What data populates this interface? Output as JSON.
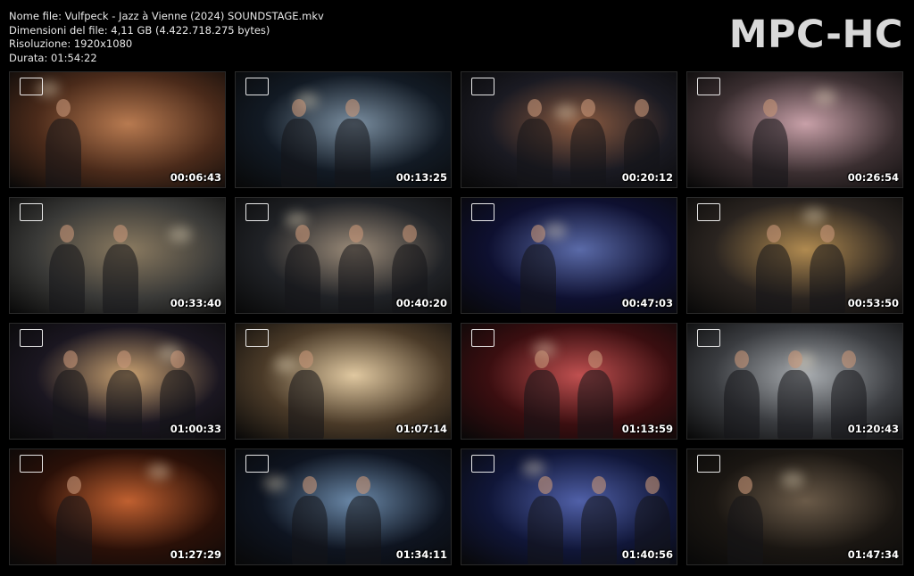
{
  "header": {
    "file_name": "Nome file: Vulfpeck - Jazz à Vienne (2024) SOUNDSTAGE.mkv",
    "file_size": "Dimensioni del file: 4,11 GB (4.422.718.275 bytes)",
    "resolution": "Risoluzione: 1920x1080",
    "duration": "Durata: 01:54:22",
    "brand": "MPC-HC"
  },
  "thumbnails": [
    {
      "time": "00:06:43",
      "bg": "#4a2a1a",
      "accent": "#b87a50"
    },
    {
      "time": "00:13:25",
      "bg": "#121a24",
      "accent": "#7a8ea0"
    },
    {
      "time": "00:20:12",
      "bg": "#1a1a22",
      "accent": "#8a5a40"
    },
    {
      "time": "00:26:54",
      "bg": "#3a2e30",
      "accent": "#c8a0a8"
    },
    {
      "time": "00:33:40",
      "bg": "#3a3a38",
      "accent": "#8a7a60"
    },
    {
      "time": "00:40:20",
      "bg": "#202226",
      "accent": "#9a8a78"
    },
    {
      "time": "00:47:03",
      "bg": "#0e1030",
      "accent": "#5a6aa8"
    },
    {
      "time": "00:53:50",
      "bg": "#2a2420",
      "accent": "#b08a50"
    },
    {
      "time": "01:00:33",
      "bg": "#1a1620",
      "accent": "#c8a070"
    },
    {
      "time": "01:07:14",
      "bg": "#4a3a28",
      "accent": "#e0c8a0"
    },
    {
      "time": "01:13:59",
      "bg": "#3a0e10",
      "accent": "#c05050"
    },
    {
      "time": "01:20:43",
      "bg": "#3a3c40",
      "accent": "#a8acb0"
    },
    {
      "time": "01:27:29",
      "bg": "#2a1008",
      "accent": "#c06030"
    },
    {
      "time": "01:34:11",
      "bg": "#0e1420",
      "accent": "#6a88a8"
    },
    {
      "time": "01:40:56",
      "bg": "#101638",
      "accent": "#5060a8"
    },
    {
      "time": "01:47:34",
      "bg": "#1a1612",
      "accent": "#6a5a48"
    }
  ]
}
